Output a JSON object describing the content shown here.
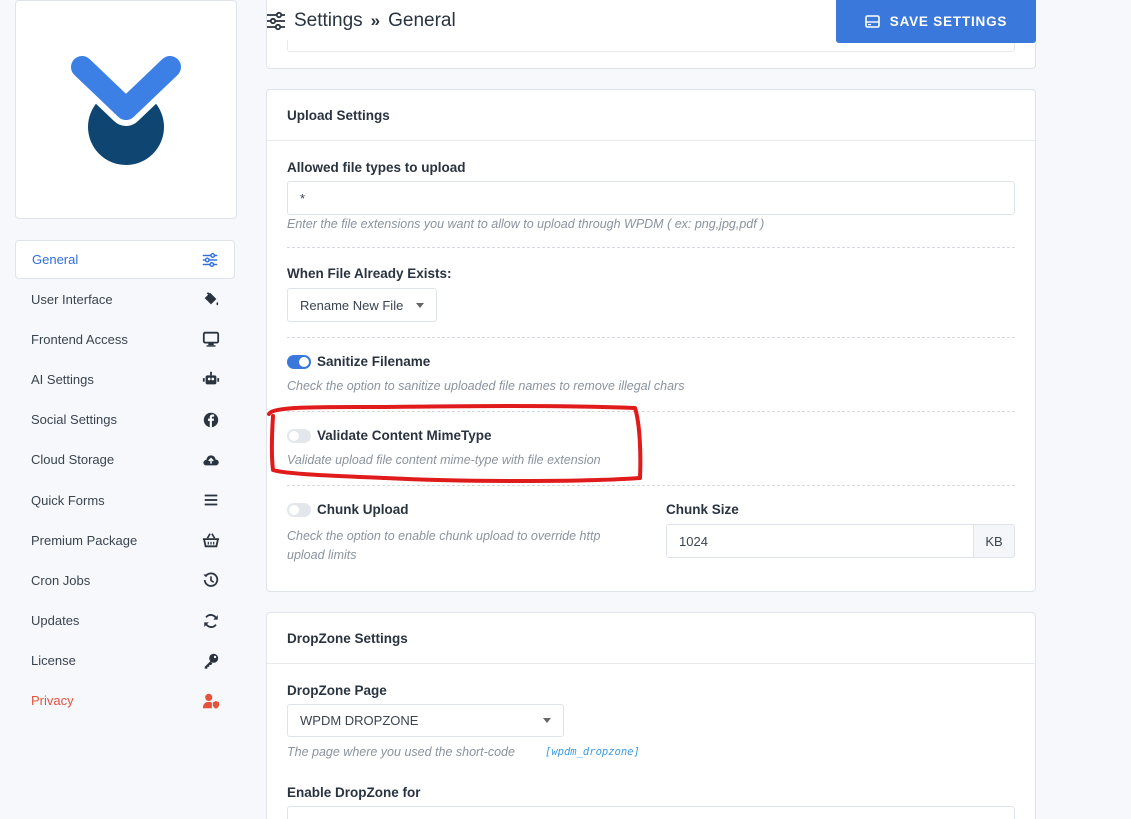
{
  "header": {
    "title": "Settings",
    "subtitle": "General",
    "save_label": "SAVE SETTINGS"
  },
  "sidebar": {
    "items": [
      {
        "label": "General",
        "icon": "sliders-icon"
      },
      {
        "label": "User Interface",
        "icon": "paint-bucket-icon"
      },
      {
        "label": "Frontend Access",
        "icon": "monitor-icon"
      },
      {
        "label": "AI Settings",
        "icon": "robot-icon"
      },
      {
        "label": "Social Settings",
        "icon": "facebook-icon"
      },
      {
        "label": "Cloud Storage",
        "icon": "cloud-upload-icon"
      },
      {
        "label": "Quick Forms",
        "icon": "list-icon"
      },
      {
        "label": "Premium Package",
        "icon": "basket-icon"
      },
      {
        "label": "Cron Jobs",
        "icon": "history-icon"
      },
      {
        "label": "Updates",
        "icon": "sync-icon"
      },
      {
        "label": "License",
        "icon": "key-icon"
      },
      {
        "label": "Privacy",
        "icon": "user-shield-icon"
      }
    ]
  },
  "upload": {
    "title": "Upload Settings",
    "allowed_label": "Allowed file types to upload",
    "allowed_value": "*",
    "allowed_help": "Enter the file extensions you want to allow to upload through WPDM ( ex: png,jpg,pdf )",
    "exists_label": "When File Already Exists:",
    "exists_value": "Rename New File",
    "sanitize_label": "Sanitize Filename",
    "sanitize_help": "Check the option to sanitize uploaded file names to remove illegal chars",
    "sanitize_on": true,
    "mime_label": "Validate Content MimeType",
    "mime_help": "Validate upload file content mime-type with file extension",
    "mime_on": false,
    "chunk_label": "Chunk Upload",
    "chunk_help": "Check the option to enable chunk upload to override http upload limits",
    "chunk_on": false,
    "chunk_size_label": "Chunk Size",
    "chunk_size_value": "1024",
    "chunk_size_unit": "KB"
  },
  "dropzone": {
    "title": "DropZone Settings",
    "page_label": "DropZone Page",
    "page_value": "WPDM DROPZONE",
    "page_help": "The page where you used the short-code",
    "shortcode": "[wpdm_dropzone]",
    "enable_label": "Enable DropZone for"
  },
  "colors": {
    "accent": "#3b78dc",
    "privacy": "#e5533d",
    "annotation": "#e01b1b"
  }
}
